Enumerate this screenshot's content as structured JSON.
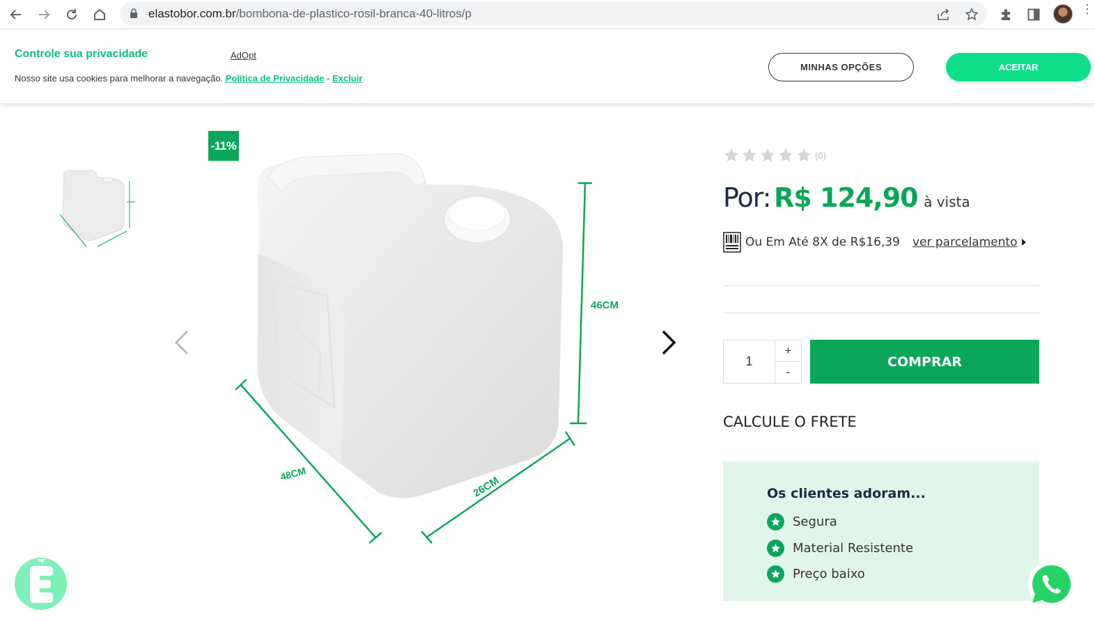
{
  "browser": {
    "url_host": "elastobor.com.br",
    "url_path": "/bombona-de-plastico-rosil-branca-40-litros/p"
  },
  "cookie_banner": {
    "title": "Controle sua privacidade",
    "brand": "AdOpt",
    "message": "Nosso site usa cookies para melhorar a navegação.",
    "privacy_link": "Política de Privacidade",
    "separator": "-",
    "delete_link": "Excluir",
    "options_button": "MINHAS OPÇÕES",
    "accept_button": "ACEITAR",
    "accent_color": "#0fdf8b"
  },
  "gallery": {
    "discount_badge": "-11%",
    "dimensions": {
      "height": "46CM",
      "length": "48CM",
      "width": "26CM"
    }
  },
  "product": {
    "rating_count": "(0)",
    "rating_value": 0,
    "price_prefix": "Por:",
    "price": "R$ 124,90",
    "price_suffix": "à vista",
    "installments_text": "Ou Em Até 8X de R$16,39",
    "installments_link": "ver parcelamento",
    "quantity": "1",
    "plus": "+",
    "minus": "-",
    "buy_button": "COMPRAR",
    "shipping_title": "CALCULE O FRETE",
    "brand_color": "#0ca65a"
  },
  "customers_love": {
    "title": "Os clientes adoram...",
    "items": [
      "Segura",
      "Material Resistente",
      "Preço baixo"
    ]
  }
}
